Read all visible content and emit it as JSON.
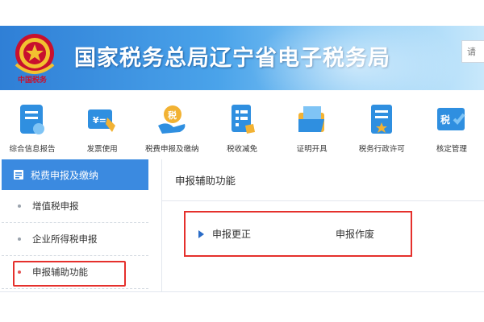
{
  "header": {
    "title": "国家税务总局辽宁省电子税务局",
    "emblem_caption": "中国税务",
    "search_placeholder": "请"
  },
  "nav": {
    "items": [
      {
        "label": "综合信息报告",
        "icon": "report-form-icon"
      },
      {
        "label": "发票使用",
        "icon": "invoice-icon"
      },
      {
        "label": "税费申报及缴纳",
        "icon": "tax-payment-icon"
      },
      {
        "label": "税收减免",
        "icon": "tax-relief-icon"
      },
      {
        "label": "证明开具",
        "icon": "certificate-folder-icon"
      },
      {
        "label": "税务行政许可",
        "icon": "license-icon"
      },
      {
        "label": "核定管理",
        "icon": "verification-icon"
      }
    ]
  },
  "sidebar": {
    "header": "税费申报及缴纳",
    "items": [
      {
        "label": "增值税申报"
      },
      {
        "label": "企业所得税申报"
      },
      {
        "label": "申报辅助功能"
      }
    ]
  },
  "main": {
    "title": "申报辅助功能",
    "functions": [
      "申报更正",
      "申报作废"
    ]
  },
  "colors": {
    "brand_blue": "#3b8ae0",
    "highlight_red": "#e5302c"
  }
}
